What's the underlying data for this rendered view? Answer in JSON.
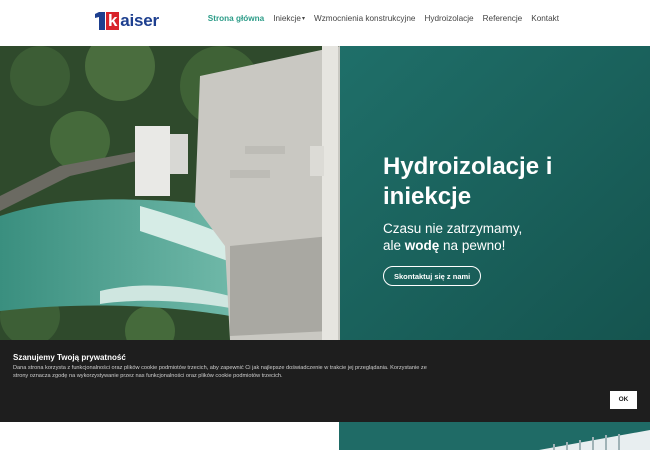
{
  "brand": {
    "logo_number": "1",
    "logo_k": "k",
    "logo_rest": "aiser",
    "color_red": "#d8232a",
    "color_blue": "#1d3f8f"
  },
  "nav": {
    "items": [
      {
        "label": "Strona główna",
        "active": true
      },
      {
        "label": "Iniekcje",
        "has_dropdown": true
      },
      {
        "label": "Wzmocnienia konstrukcyjne"
      },
      {
        "label": "Hydroizolacje"
      },
      {
        "label": "Referencje"
      },
      {
        "label": "Kontakt"
      }
    ],
    "active_color": "#2c9c88"
  },
  "hero": {
    "title": "Hydroizolacje i iniekcje",
    "subtitle_line1": "Czasu nie zatrzymamy,",
    "subtitle_line2_pre": "ale ",
    "subtitle_line2_bold": "wodę",
    "subtitle_line2_post": " na pewno!",
    "cta_label": "Skontaktuj się z nami",
    "water_color": "#1d6b66"
  },
  "cookie": {
    "title": "Szanujemy Twoją prywatność",
    "text": "Dana strona korzysta z funkcjonalności oraz plików cookie podmiotów trzecich, aby zapewnić Ci jak najlepsze doświadczenie w trakcie jej przeglądania. Korzystanie ze strony oznacza zgodę na wykorzystywanie przez nas funkcjonalności oraz plików cookie podmiotów trzecich.",
    "ok_label": "OK"
  }
}
